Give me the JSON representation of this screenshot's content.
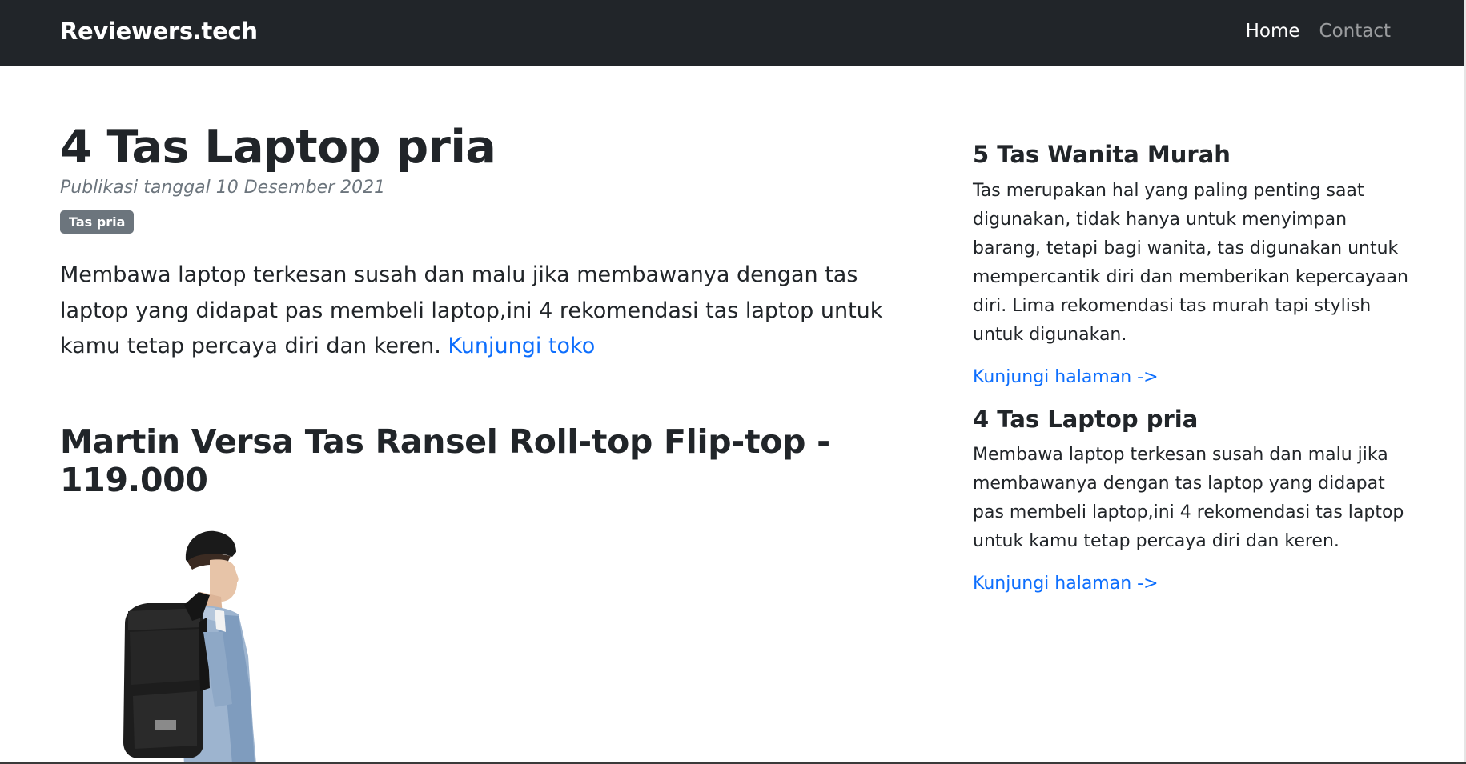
{
  "navbar": {
    "brand": "Reviewers.tech",
    "links": [
      {
        "label": "Home",
        "active": true
      },
      {
        "label": "Contact",
        "active": false
      }
    ]
  },
  "article": {
    "title": "4 Tas Laptop pria",
    "meta": "Publikasi tanggal 10 Desember 2021",
    "badge": "Tas pria",
    "lead_text": "Membawa laptop terkesan susah dan malu jika membawanya dengan tas laptop yang didapat pas membeli laptop,ini 4 rekomendasi tas laptop untuk kamu tetap percaya diri dan keren.",
    "lead_link": "Kunjungi toko",
    "product_title": "Martin Versa Tas Ransel Roll-top Flip-top - 119.000",
    "product_image_desc": "man-wearing-black-backpack"
  },
  "sidebar": {
    "cards": [
      {
        "title": "5 Tas Wanita Murah",
        "text": "Tas merupakan hal yang paling penting saat digunakan, tidak hanya untuk menyimpan barang, tetapi bagi wanita, tas digunakan untuk mempercantik diri dan memberikan kepercayaan diri. Lima rekomendasi tas murah tapi stylish untuk digunakan.",
        "link": "Kunjungi halaman ->"
      },
      {
        "title": "4 Tas Laptop pria",
        "text": "Membawa laptop terkesan susah dan malu jika membawanya dengan tas laptop yang didapat pas membeli laptop,ini 4 rekomendasi tas laptop untuk kamu tetap percaya diri dan keren.",
        "link": "Kunjungi halaman ->"
      }
    ]
  },
  "colors": {
    "navbar_bg": "#212529",
    "link": "#0d6efd",
    "badge_bg": "#6c757d",
    "muted": "#6c757d"
  }
}
